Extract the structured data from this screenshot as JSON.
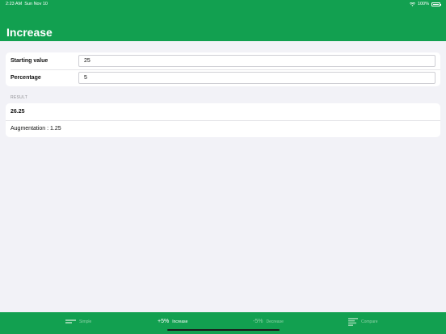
{
  "status_bar": {
    "time": "2:23 AM",
    "date": "Sun Nov 10",
    "battery": "100%"
  },
  "header": {
    "title": "Increase"
  },
  "inputs": {
    "starting_value_label": "Starting value",
    "starting_value": "25",
    "percentage_label": "Percentage",
    "percentage": "5"
  },
  "result": {
    "section_label": "RESULT",
    "value": "26.25",
    "augmentation": "Augmentation : 1.25"
  },
  "tabs": [
    {
      "label": "Simple",
      "icon": "bars-icon",
      "active": false
    },
    {
      "label": "Increase",
      "glyph": "+5%",
      "active": true
    },
    {
      "label": "Decrease",
      "glyph": "-5%",
      "active": false
    },
    {
      "label": "Compare",
      "icon": "compare-bars-icon",
      "active": false
    }
  ],
  "colors": {
    "accent": "#12a050",
    "tab_inactive": "#8fd3a8",
    "background": "#f2f2f7"
  }
}
